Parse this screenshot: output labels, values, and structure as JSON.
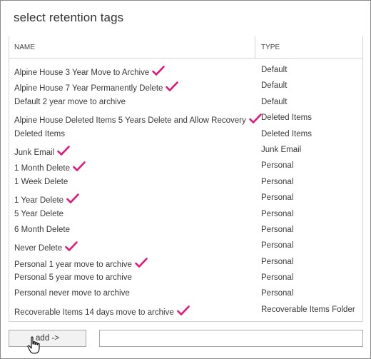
{
  "dialog": {
    "title": "select retention tags"
  },
  "table": {
    "columns": {
      "name": "NAME",
      "type": "TYPE"
    },
    "rows": [
      {
        "name": "Alpine House 3 Year Move to Archive",
        "type": "Default",
        "checked": true
      },
      {
        "name": "Alpine House 7 Year Permanently Delete",
        "type": "Default",
        "checked": true
      },
      {
        "name": "Default 2 year move to archive",
        "type": "Default",
        "checked": false
      },
      {
        "name": "Alpine House Deleted Items 5 Years Delete and Allow Recovery",
        "type": "Deleted Items",
        "checked": true
      },
      {
        "name": "Deleted Items",
        "type": "Deleted Items",
        "checked": false
      },
      {
        "name": "Junk Email",
        "type": "Junk Email",
        "checked": true
      },
      {
        "name": "1 Month Delete",
        "type": "Personal",
        "checked": true
      },
      {
        "name": "1 Week Delete",
        "type": "Personal",
        "checked": false
      },
      {
        "name": "1 Year Delete",
        "type": "Personal",
        "checked": true
      },
      {
        "name": "5 Year Delete",
        "type": "Personal",
        "checked": false
      },
      {
        "name": "6 Month Delete",
        "type": "Personal",
        "checked": false
      },
      {
        "name": "Never Delete",
        "type": "Personal",
        "checked": true
      },
      {
        "name": "Personal 1 year move to archive",
        "type": "Personal",
        "checked": true
      },
      {
        "name": "Personal 5 year move to archive",
        "type": "Personal",
        "checked": false
      },
      {
        "name": "Personal never move to archive",
        "type": "Personal",
        "checked": false
      },
      {
        "name": "Recoverable Items 14 days move to archive",
        "type": "Recoverable Items Folder",
        "checked": true
      }
    ]
  },
  "actions": {
    "add_label": "add ->",
    "selected_value": ""
  },
  "colors": {
    "check_mark": "#e3157a"
  }
}
